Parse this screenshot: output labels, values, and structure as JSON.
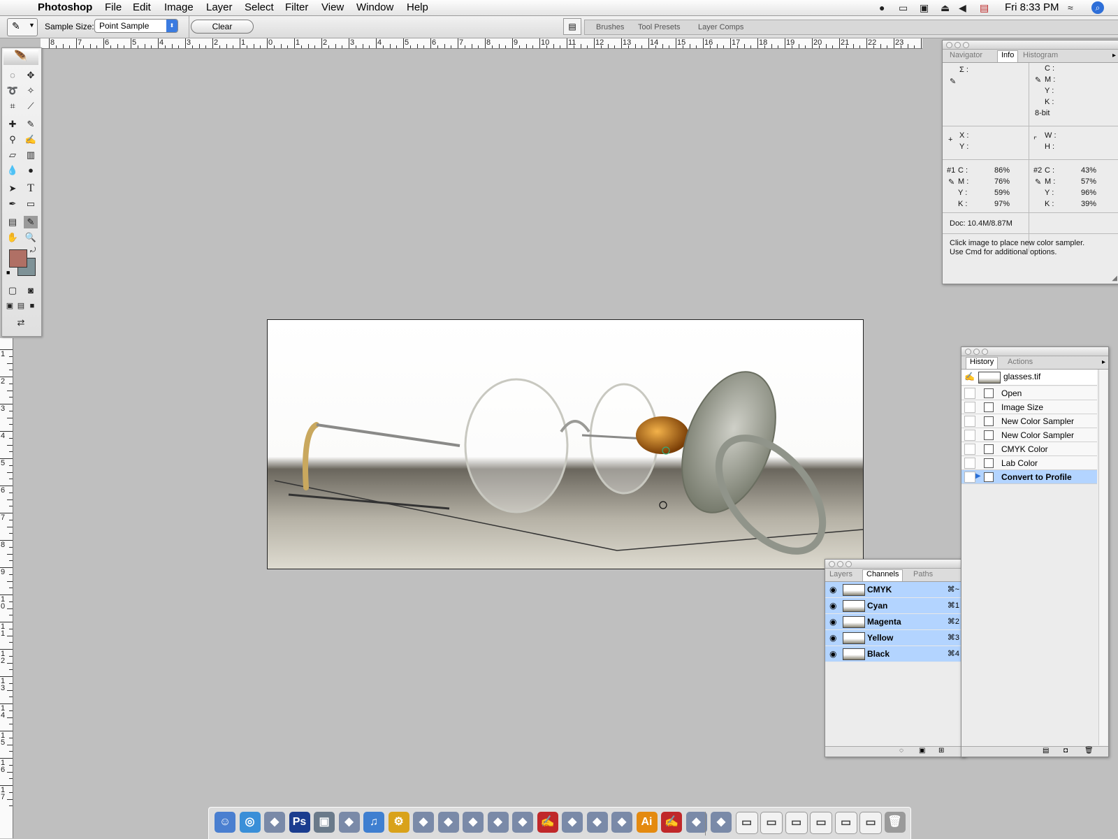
{
  "menubar": {
    "app": "Photoshop",
    "items": [
      "File",
      "Edit",
      "Image",
      "Layer",
      "Select",
      "Filter",
      "View",
      "Window",
      "Help"
    ],
    "clock": "Fri 8:33 PM"
  },
  "options": {
    "sample_size_label": "Sample Size:",
    "sample_size_value": "Point Sample",
    "clear_label": "Clear",
    "well_tabs": [
      "Brushes",
      "Tool Presets",
      "Layer Comps"
    ]
  },
  "hruler_labels": [
    "8",
    "7",
    "6",
    "5",
    "4",
    "3",
    "2",
    "1",
    "0",
    "1",
    "2",
    "3",
    "4",
    "5",
    "6",
    "7",
    "8",
    "9",
    "10",
    "11",
    "12",
    "13",
    "14",
    "15",
    "16",
    "17",
    "18",
    "19",
    "20",
    "21",
    "22",
    "23",
    "24"
  ],
  "vruler_labels": [
    "1",
    "2",
    "3",
    "4",
    "5",
    "6",
    "7",
    "8",
    "9",
    "10",
    "11",
    "12",
    "13",
    "14",
    "15",
    "16",
    "17"
  ],
  "info_panel": {
    "tabs": [
      "Navigator",
      "Info",
      "Histogram"
    ],
    "active_tab": "Info",
    "sigma": "Σ :",
    "cmyk_labels": [
      "C :",
      "M :",
      "Y :",
      "K :"
    ],
    "bit_depth": "8-bit",
    "x_label": "X :",
    "y_label": "Y :",
    "w_label": "W :",
    "h_label": "H :",
    "sampler1": {
      "tag": "#1",
      "C": "86%",
      "M": "76%",
      "Y": "59%",
      "K": "97%"
    },
    "sampler2": {
      "tag": "#2",
      "C": "43%",
      "M": "57%",
      "Y": "96%",
      "K": "39%"
    },
    "doc": "Doc: 10.4M/8.87M",
    "hint_line1": "Click image to place new color sampler.",
    "hint_line2": "Use Cmd for additional options."
  },
  "history_panel": {
    "tabs": [
      "History",
      "Actions"
    ],
    "active_tab": "History",
    "snapshot": "glasses.tif",
    "items": [
      "Open",
      "Image Size",
      "New Color Sampler",
      "New Color Sampler",
      "CMYK Color",
      "Lab Color",
      "Convert to Profile"
    ],
    "selected": "Convert to Profile"
  },
  "channels_panel": {
    "tabs": [
      "Layers",
      "Channels",
      "Paths"
    ],
    "active_tab": "Channels",
    "channels": [
      {
        "name": "CMYK",
        "shortcut": "⌘~"
      },
      {
        "name": "Cyan",
        "shortcut": "⌘1"
      },
      {
        "name": "Magenta",
        "shortcut": "⌘2"
      },
      {
        "name": "Yellow",
        "shortcut": "⌘3"
      },
      {
        "name": "Black",
        "shortcut": "⌘4"
      }
    ]
  },
  "toolbox": {
    "foreground_color": "#b07065",
    "background_color": "#7e9297"
  },
  "dock": {
    "items": [
      "finder-icon",
      "safari-icon",
      "app-icon",
      "photoshop-icon",
      "preview-icon",
      "app-icon",
      "itunes-icon",
      "system-prefs-icon",
      "app-icon",
      "app-icon",
      "app-icon",
      "app-icon",
      "app-icon",
      "acrobat-icon",
      "app-icon",
      "app-icon",
      "app-icon",
      "illustrator-icon",
      "acrobat-icon",
      "app-icon",
      "app-icon",
      "window-icon",
      "window-icon",
      "window-icon",
      "window-icon",
      "window-icon",
      "window-icon",
      "trash-icon"
    ],
    "ps_label": "Ps",
    "ai_label": "Ai"
  }
}
